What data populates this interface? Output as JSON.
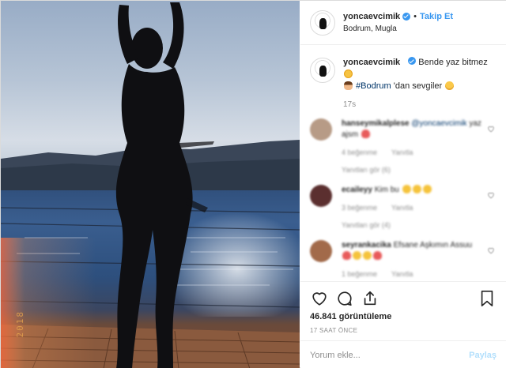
{
  "post": {
    "date_stamp": "2018"
  },
  "header": {
    "username": "yoncaevcimik",
    "separator": "•",
    "follow_label": "Takip Et",
    "location": "Bodrum, Mugla",
    "more_icon": "more-icon"
  },
  "caption": {
    "username": "yoncaevcimik",
    "text_part1": "Bende yaz bitmez",
    "hashtag": "#Bodrum",
    "text_part2": "'dan sevgiler",
    "time_ago": "17s"
  },
  "comments": [
    {
      "username": "hanseymikalplese",
      "mention": "@yoncaevcimik",
      "text": "yaz ajsm",
      "likes": "4 beğenme",
      "reply": "Yanıtla",
      "replies": "Yanıtları gör (6)",
      "avatar_color": "#b79b86"
    },
    {
      "username": "ecaileyy",
      "mention": "",
      "text": "Kim bu",
      "likes": "3 beğenme",
      "reply": "Yanıtla",
      "replies": "Yanıtları gör (4)",
      "avatar_color": "#5b2f2f"
    },
    {
      "username": "seyrankacika",
      "mention": "",
      "text": "Efsane Aşkımın Assuu",
      "likes": "1 beğenme",
      "reply": "Yanıtla",
      "replies": "",
      "avatar_color": "#a26a4a"
    }
  ],
  "actions": {
    "like_icon": "heart-icon",
    "comment_icon": "comment-icon",
    "share_icon": "share-icon",
    "save_icon": "bookmark-icon",
    "views": "46.841 görüntüleme",
    "posted": "17 SAAT ÖNCE"
  },
  "add_comment": {
    "placeholder": "Yorum ekle...",
    "post_label": "Paylaş"
  },
  "colors": {
    "link_blue": "#3897f0",
    "hashtag": "#003569",
    "muted": "#8e8e8e",
    "post_disabled": "#b2dffc"
  }
}
